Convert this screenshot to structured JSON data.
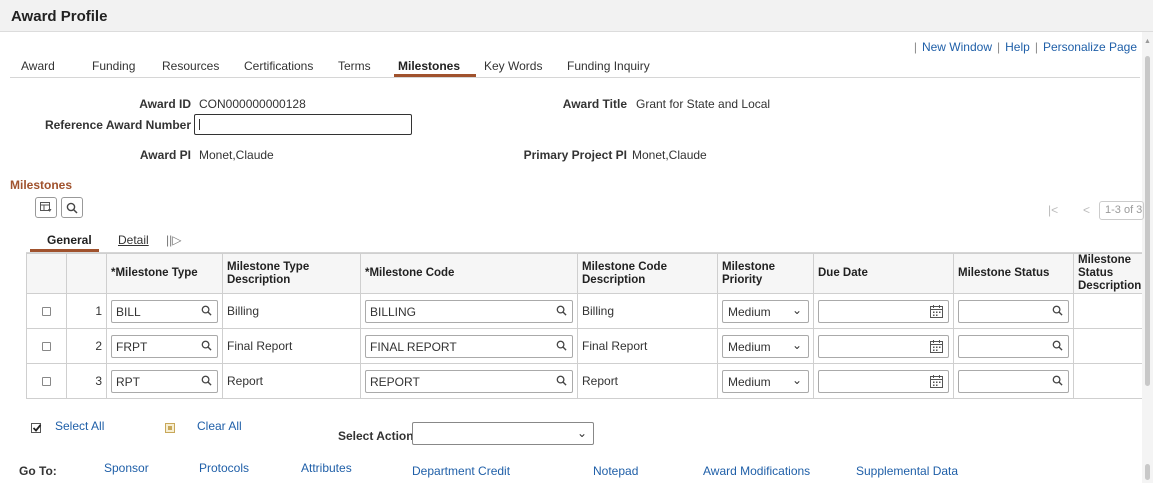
{
  "page_title": "Award Profile",
  "top_links": {
    "new_window": "New Window",
    "help": "Help",
    "personalize": "Personalize Page"
  },
  "tabs": [
    "Award",
    "Funding",
    "Resources",
    "Certifications",
    "Terms",
    "Milestones",
    "Key Words",
    "Funding Inquiry"
  ],
  "active_tab": "Milestones",
  "header": {
    "award_id_label": "Award ID",
    "award_id": "CON000000000128",
    "award_title_label": "Award Title",
    "award_title": "Grant for State and Local",
    "ref_award_label": "Reference Award Number",
    "ref_award_value": "",
    "award_pi_label": "Award PI",
    "award_pi": "Monet,Claude",
    "primary_pi_label": "Primary Project PI",
    "primary_pi": "Monet,Claude"
  },
  "milestones": {
    "section_title": "Milestones",
    "pager_text": "1-3 of 3",
    "subtabs": [
      "General",
      "Detail"
    ],
    "active_subtab": "General",
    "columns": [
      "*Milestone Type",
      "Milestone Type Description",
      "*Milestone Code",
      "Milestone Code Description",
      "Milestone Priority",
      "Due Date",
      "Milestone Status",
      "Milestone Status Description"
    ],
    "rows": [
      {
        "num": "1",
        "type": "BILL",
        "type_desc": "Billing",
        "code": "BILLING",
        "code_desc": "Billing",
        "priority": "Medium",
        "due_date": "",
        "status": "",
        "status_desc": ""
      },
      {
        "num": "2",
        "type": "FRPT",
        "type_desc": "Final Report",
        "code": "FINAL REPORT",
        "code_desc": "Final Report",
        "priority": "Medium",
        "due_date": "",
        "status": "",
        "status_desc": ""
      },
      {
        "num": "3",
        "type": "RPT",
        "type_desc": "Report",
        "code": "REPORT",
        "code_desc": "Report",
        "priority": "Medium",
        "due_date": "",
        "status": "",
        "status_desc": ""
      }
    ]
  },
  "actions": {
    "select_all": "Select All",
    "clear_all": "Clear All",
    "select_action_label": "Select Action",
    "select_action_value": ""
  },
  "goto": {
    "label": "Go To:",
    "links": [
      "Sponsor",
      "Protocols",
      "Attributes",
      "Department Credit",
      "Notepad",
      "Award Modifications",
      "Supplemental Data"
    ]
  },
  "colors": {
    "accent": "#a0522d",
    "link": "#1f5fa8"
  },
  "icons": [
    "search-icon",
    "calendar-icon",
    "chevron-down-icon",
    "grid-personalize-icon",
    "first-page-icon",
    "previous-page-icon",
    "show-all-columns-icon",
    "checkmark-icon"
  ]
}
